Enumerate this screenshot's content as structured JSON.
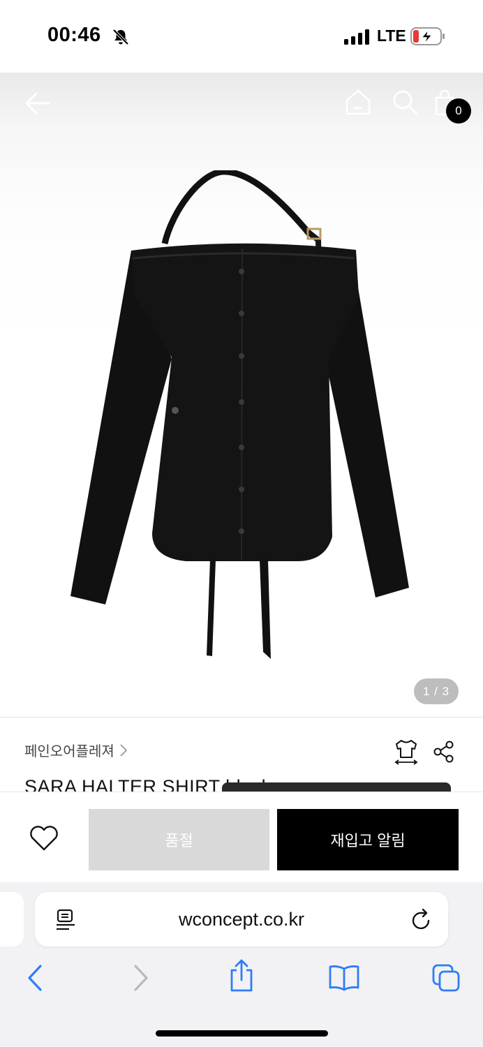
{
  "status_bar": {
    "time": "00:46",
    "carrier": "LTE"
  },
  "header": {
    "cart_count": "0"
  },
  "gallery": {
    "page_indicator": "1 / 3"
  },
  "product": {
    "brand": "페인오어플레져",
    "title": "SARA HALTER SHIRT black"
  },
  "actions": {
    "soldout_label": "품절",
    "restock_label": "재입고 알림"
  },
  "browser": {
    "url": "wconcept.co.kr"
  },
  "colors": {
    "accent": "#000000",
    "disabled": "#d9d9d9",
    "ios_blue": "#2f7cf6"
  }
}
